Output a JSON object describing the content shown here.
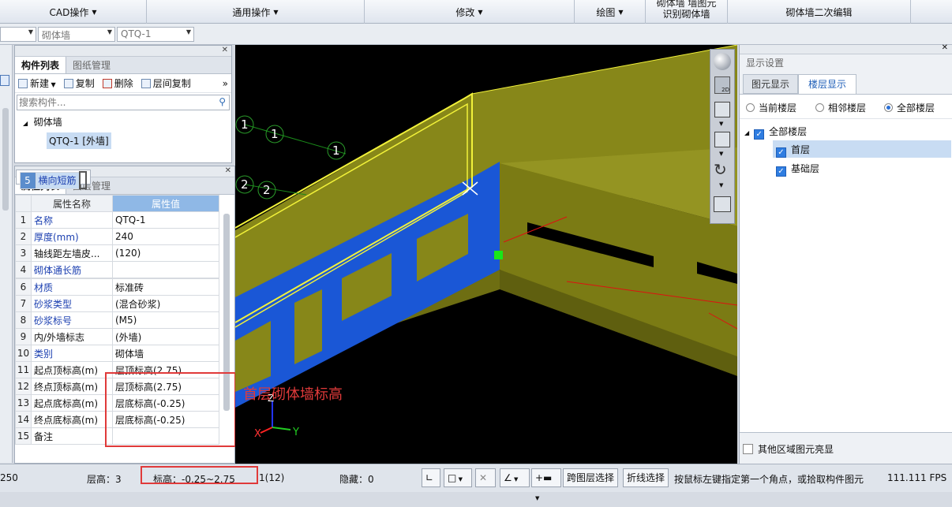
{
  "ribbon": {
    "groups": [
      {
        "label": "CAD操作"
      },
      {
        "label": "通用操作"
      },
      {
        "label": "修改"
      },
      {
        "label": "绘图"
      },
      {
        "label": "识别砌体墙",
        "top_partial": "砌体墙  墙图元"
      },
      {
        "label": "砌体墙二次编辑"
      }
    ]
  },
  "selectors": {
    "floor": "",
    "category": "砌体墙",
    "component": "QTQ-1"
  },
  "component_panel": {
    "tabs": [
      "构件列表",
      "图纸管理"
    ],
    "toolbar": {
      "new": "新建",
      "copy": "复制",
      "delete": "删除",
      "floor_copy": "层间复制",
      "more": "»"
    },
    "search_placeholder": "搜索构件...",
    "tree": {
      "group": "砌体墙",
      "item": "QTQ-1 [外墙]"
    }
  },
  "property_panel": {
    "tabs": [
      "属性列表",
      "图层管理"
    ],
    "headers": {
      "name": "属性名称",
      "value": "属性值"
    },
    "rows": [
      {
        "n": "1",
        "name": "名称",
        "value": "QTQ-1"
      },
      {
        "n": "2",
        "name": "厚度(mm)",
        "value": "240"
      },
      {
        "n": "3",
        "name": "轴线距左墙皮...",
        "value": "(120)"
      },
      {
        "n": "4",
        "name": "砌体通长筋",
        "value": ""
      },
      {
        "n": "5",
        "name": "横向短筋",
        "value": ""
      },
      {
        "n": "6",
        "name": "材质",
        "value": "标准砖"
      },
      {
        "n": "7",
        "name": "砂浆类型",
        "value": "(混合砂浆)"
      },
      {
        "n": "8",
        "name": "砂浆标号",
        "value": "(M5)"
      },
      {
        "n": "9",
        "name": "内/外墙标志",
        "value": "(外墙)"
      },
      {
        "n": "10",
        "name": "类别",
        "value": "砌体墙"
      },
      {
        "n": "11",
        "name": "起点顶标高(m)",
        "value": "层顶标高(2.75)"
      },
      {
        "n": "12",
        "name": "终点顶标高(m)",
        "value": "层顶标高(2.75)"
      },
      {
        "n": "13",
        "name": "起点底标高(m)",
        "value": "层底标高(-0.25)"
      },
      {
        "n": "14",
        "name": "终点底标高(m)",
        "value": "层底标高(-0.25)"
      },
      {
        "n": "15",
        "name": "备注",
        "value": ""
      }
    ]
  },
  "viewport": {
    "annotation": "首层砌体墙标高",
    "axis_labels": {
      "z": "Z",
      "x": "X",
      "y": "Y"
    },
    "grid_markers": [
      "1",
      "1",
      "1",
      "2",
      "2"
    ]
  },
  "display_settings": {
    "title": "显示设置",
    "tabs": [
      "图元显示",
      "楼层显示"
    ],
    "radios": [
      "当前楼层",
      "相邻楼层",
      "全部楼层"
    ],
    "tree": {
      "root": "全部楼层",
      "children": [
        "首层",
        "基础层"
      ]
    },
    "bottom_checkbox": "其他区域图元亮显"
  },
  "status": {
    "scale": "250",
    "floor_height_label": "层高：",
    "floor_height": "3",
    "elevation_label": "标高：",
    "elevation": "-0.25~2.75",
    "count": "1(12)",
    "hidden_label": "隐藏：",
    "hidden": "0",
    "btn_cross_floor": "跨图层选择",
    "btn_polyline": "折线选择",
    "hint": "按鼠标左键指定第一个角点，或拾取构件图元",
    "fps": "111.111 FPS"
  },
  "colors": {
    "wall_olive": "#878719",
    "wall_blue": "#1a57d6",
    "highlight_yellow": "#f2f23a",
    "annotation_red": "#e03a3a"
  }
}
